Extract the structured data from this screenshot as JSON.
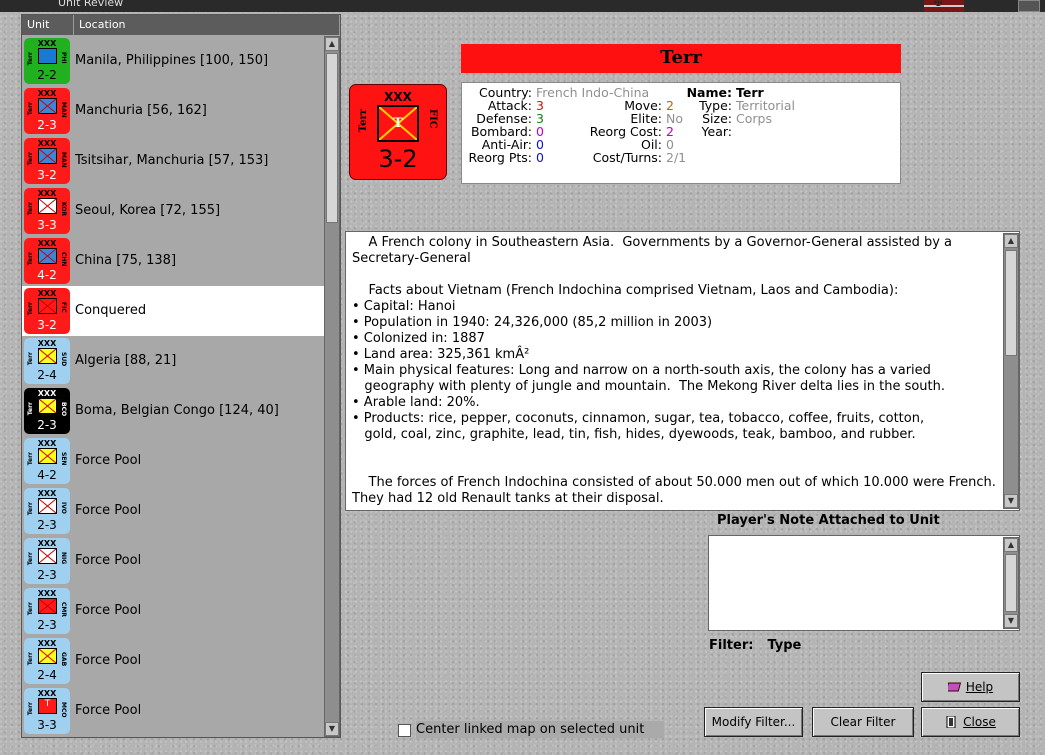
{
  "window": {
    "title": "Unit Review"
  },
  "list": {
    "headers": {
      "unit": "Unit",
      "location": "Location"
    },
    "rows": [
      {
        "location": "Manila, Philippines [100, 150]",
        "strength": "2-2",
        "side_left": "Terr",
        "side_right": "PHI",
        "bg": "#20b020",
        "box": "#1a7ad0",
        "icon": "blue"
      },
      {
        "location": "Manchuria [56, 162]",
        "strength": "2-3",
        "side_left": "Terr",
        "side_right": "MAN",
        "bg": "#ff1a1a",
        "box": "#3a86d8",
        "icon": "cross"
      },
      {
        "location": "Tsitsihar, Manchuria [57, 153]",
        "strength": "3-2",
        "side_left": "Terr",
        "side_right": "MAN",
        "bg": "#ff1a1a",
        "box": "#3a86d8",
        "icon": "cross"
      },
      {
        "location": "Seoul, Korea [72, 155]",
        "strength": "3-3",
        "side_left": "Terr",
        "side_right": "KOR",
        "bg": "#ff1a1a",
        "box": "#ffffff",
        "icon": "cross"
      },
      {
        "location": "China [75, 138]",
        "strength": "4-2",
        "side_left": "Terr",
        "side_right": "CHN",
        "bg": "#ff1a1a",
        "box": "#3a86d8",
        "icon": "cross"
      },
      {
        "location": "Conquered",
        "strength": "3-2",
        "side_left": "Terr",
        "side_right": "FIC",
        "bg": "#ff1a1a",
        "box": "#ff1a1a",
        "icon": "cross",
        "selected": true
      },
      {
        "location": "Algeria [88, 21]",
        "strength": "2-4",
        "side_left": "Terr",
        "side_right": "SUD",
        "bg": "#9fd0f0",
        "box": "#ffff20",
        "icon": "cross"
      },
      {
        "location": "Boma, Belgian Congo [124, 40]",
        "strength": "2-3",
        "side_left": "Terr",
        "side_right": "BCO",
        "bg": "#000000",
        "box": "#ffff20",
        "icon": "cross"
      },
      {
        "location": "Force Pool",
        "strength": "4-2",
        "side_left": "Terr",
        "side_right": "SEN",
        "bg": "#9fd0f0",
        "box": "#ffff20",
        "icon": "cross"
      },
      {
        "location": "Force Pool",
        "strength": "2-3",
        "side_left": "Terr",
        "side_right": "IVO",
        "bg": "#9fd0f0",
        "box": "#ffffff",
        "icon": "cross"
      },
      {
        "location": "Force Pool",
        "strength": "2-3",
        "side_left": "Terr",
        "side_right": "NIG",
        "bg": "#9fd0f0",
        "box": "#ffffff",
        "icon": "cross"
      },
      {
        "location": "Force Pool",
        "strength": "2-3",
        "side_left": "Terr",
        "side_right": "CMR",
        "bg": "#9fd0f0",
        "box": "#ff1a1a",
        "icon": "cross"
      },
      {
        "location": "Force Pool",
        "strength": "2-4",
        "side_left": "Terr",
        "side_right": "GAB",
        "bg": "#9fd0f0",
        "box": "#ffff20",
        "icon": "cross"
      },
      {
        "location": "Force Pool",
        "strength": "3-3",
        "side_left": "Terr",
        "side_right": "MCO",
        "bg": "#9fd0f0",
        "box": "#ff1a1a",
        "icon": "t"
      }
    ]
  },
  "unit": {
    "name_banner": "Terr",
    "counter": {
      "xxx": "XXX",
      "symbol": "T",
      "strength": "3-2",
      "side_left": "Terr",
      "side_right": "FIC"
    },
    "stats": {
      "country_label": "Country:",
      "country": "French Indo-China",
      "attack_label": "Attack:",
      "attack": "3",
      "defense_label": "Defense:",
      "defense": "3",
      "bombard_label": "Bombard:",
      "bombard": "0",
      "antiair_label": "Anti-Air:",
      "antiair": "0",
      "reorgpts_label": "Reorg Pts:",
      "reorgpts": "0",
      "move_label": "Move:",
      "move": "2",
      "elite_label": "Elite:",
      "elite": "No",
      "reorgcost_label": "Reorg Cost:",
      "reorgcost": "2",
      "oil_label": "Oil:",
      "oil": "0",
      "costturns_label": "Cost/Turns:",
      "costturns": "2/1",
      "name_label": "Name:",
      "name": "Terr",
      "type_label": "Type:",
      "type": "Territorial",
      "size_label": "Size:",
      "size": "Corps",
      "year_label": "Year:",
      "year": ""
    }
  },
  "description": "    A French colony in Southeastern Asia.  Governments by a Governor-General assisted by a Secretary-General\n\n    Facts about Vietnam (French Indochina comprised Vietnam, Laos and Cambodia):\n• Capital: Hanoi\n• Population in 1940: 24,326,000 (85,2 million in 2003)\n• Colonized in: 1887\n• Land area: 325,361 kmÂ²\n• Main physical features: Long and narrow on a north-south axis, the colony has a varied\n   geography with plenty of jungle and mountain.  The Mekong River delta lies in the south.\n• Arable land: 20%.\n• Products: rice, pepper, coconuts, cinnamon, sugar, tea, tobacco, coffee, fruits, cotton,\n   gold, coal, zinc, graphite, lead, tin, fish, hides, dyewoods, teak, bamboo, and rubber.\n\n\n    The forces of French Indochina consisted of about 50.000 men out of which 10.000 were French.  They had 12 old Renault tanks at their disposal.",
  "note": {
    "label": "Player's Note Attached to Unit",
    "value": ""
  },
  "filter": {
    "label": "Filter:",
    "value": "Type"
  },
  "buttons": {
    "help": "Help",
    "modify_filter": "Modify Filter...",
    "clear_filter": "Clear Filter",
    "close": "Close"
  },
  "center_map": {
    "label": "Center linked map on selected unit",
    "checked": false
  },
  "colors": {
    "banner": "#ff1010",
    "attack": "#d01010",
    "defense": "#108010",
    "bombard": "#c000c0",
    "antiair": "#1010d0",
    "reorgpts": "#1010d0",
    "move": "#c06000",
    "muted": "#909090"
  }
}
